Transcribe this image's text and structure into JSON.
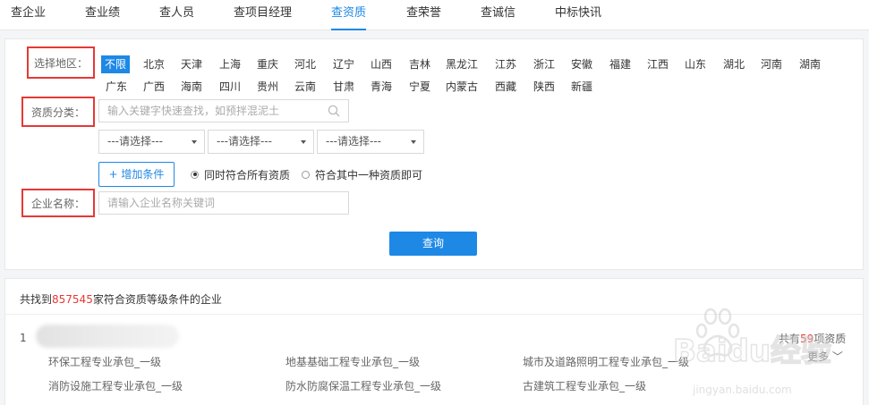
{
  "nav": {
    "tabs": [
      "查企业",
      "查业绩",
      "查人员",
      "查项目经理",
      "查资质",
      "查荣誉",
      "查诚信",
      "中标快讯"
    ],
    "active_index": 4
  },
  "filters": {
    "region_label": "选择地区：",
    "regions_row1": [
      "不限",
      "北京",
      "天津",
      "上海",
      "重庆",
      "河北",
      "辽宁",
      "山西",
      "吉林",
      "黑龙江",
      "江苏",
      "浙江",
      "安徽",
      "福建",
      "江西",
      "山东",
      "湖北",
      "河南",
      "湖南"
    ],
    "regions_row2": [
      "广东",
      "广西",
      "海南",
      "四川",
      "贵州",
      "云南",
      "甘肃",
      "青海",
      "宁夏",
      "内蒙古",
      "西藏",
      "陕西",
      "新疆"
    ],
    "qualification_label": "资质分类：",
    "qualification_placeholder": "输入关键字快速查找，如预拌混泥土",
    "selects": [
      "---请选择---",
      "---请选择---",
      "---请选择---"
    ],
    "add_condition": "增加条件",
    "radio_all": "同时符合所有资质",
    "radio_any": "符合其中一种资质即可",
    "company_label": "企业名称：",
    "company_placeholder": "请输入企业名称关键词",
    "query_button": "查询"
  },
  "results": {
    "prefix": "共找到",
    "count": "857545",
    "suffix": "家符合资质等级条件的企业",
    "row": {
      "index": "1",
      "total_prefix": "共有",
      "total_count": "59",
      "total_suffix": "项资质",
      "more": "更多",
      "qualifications": [
        "环保工程专业承包_一级",
        "地基基础工程专业承包_一级",
        "城市及道路照明工程专业承包_一级",
        "消防设施工程专业承包_一级",
        "防水防腐保温工程专业承包_一级",
        "古建筑工程专业承包_一级"
      ]
    }
  },
  "watermark": {
    "brand": "Baidu经验",
    "url": "jingyan.baidu.com"
  },
  "colors": {
    "accent": "#1e88e5",
    "highlight": "#e53935"
  }
}
